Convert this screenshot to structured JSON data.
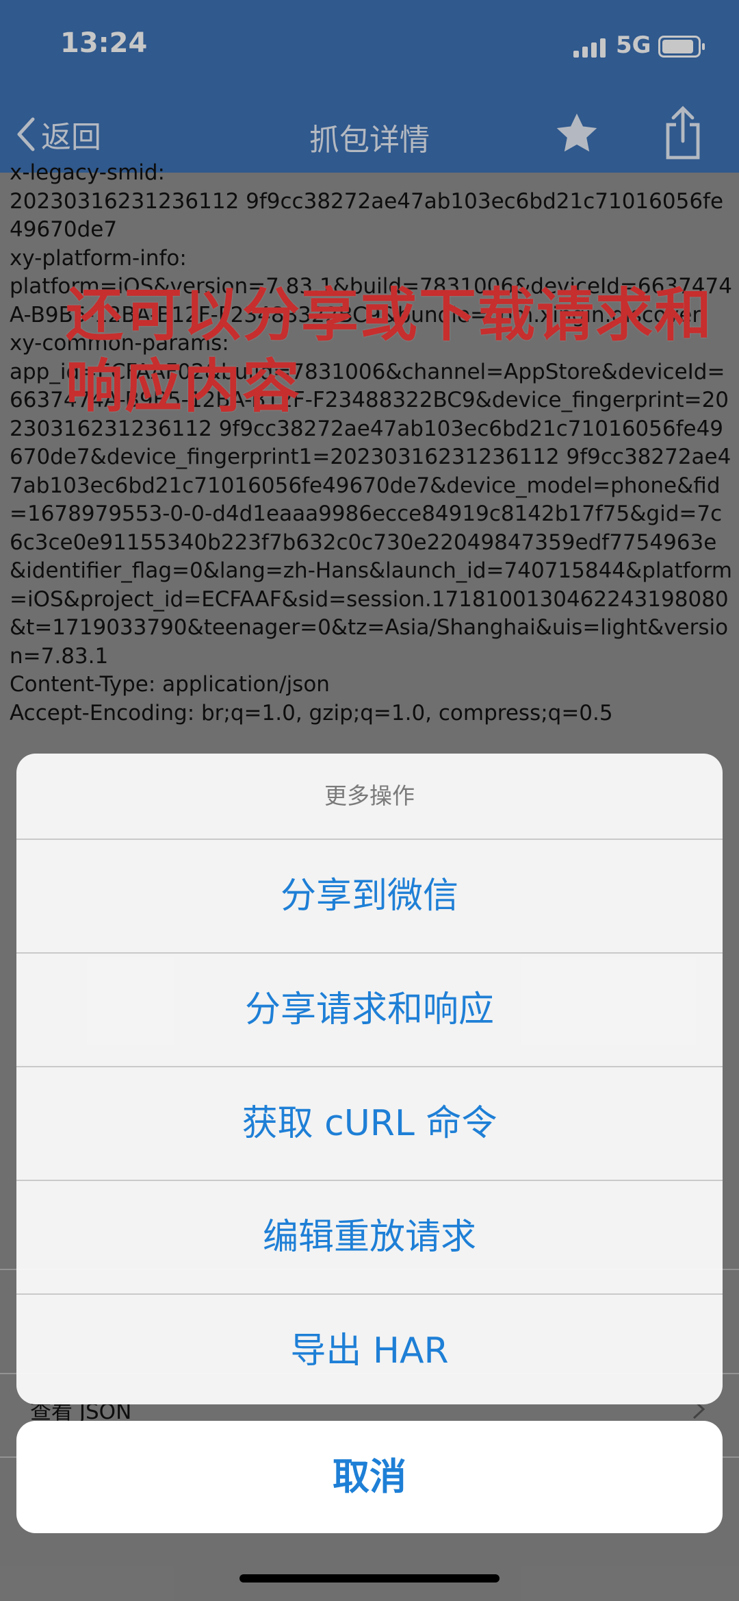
{
  "status": {
    "time": "13:24",
    "network": "5G"
  },
  "nav": {
    "back_label": "返回",
    "title": "抓包详情"
  },
  "content_text": "x-legacy-smid:\n20230316231236112 9f9cc38272ae47ab103ec6bd21c71016056fe49670de7\nxy-platform-info:\nplatform=iOS&version=7.83.1&build=7831006&deviceId=6637474A-B9B5-12BA-B12F-F23488322BC9&bundle=com.xingin.discover\nxy-common-params:\napp_id=ECFAAF02&build=7831006&channel=AppStore&deviceId=6637474A-B9B5-12BA-B12F-F23488322BC9&device_fingerprint=20230316231236112 9f9cc38272ae47ab103ec6bd21c71016056fe49670de7&device_fingerprint1=20230316231236112 9f9cc38272ae47ab103ec6bd21c71016056fe49670de7&device_model=phone&fid=1678979553-0-0-d4d1eaaa9986ecce84919c8142b17f75&gid=7c6c3ce0e91155340b223f7b632c0c730e22049847359edf7754963e&identifier_flag=0&lang=zh-Hans&launch_id=740715844&platform=iOS&project_id=ECFAAF&sid=session.1718100130462243198080&t=1719033790&teenager=0&tz=Asia/Shanghai&uis=light&version=7.83.1\nContent-Type: application/json\nAccept-Encoding: br;q=1.0, gzip;q=1.0, compress;q=0.5",
  "overlay_text": "还可以分享或下载请求和响应内容",
  "underlying_row_label": "查看 JSON",
  "sheet": {
    "title": "更多操作",
    "items": [
      "分享到微信",
      "分享请求和响应",
      "获取 cURL 命令",
      "编辑重放请求",
      "导出 HAR"
    ],
    "cancel": "取消"
  },
  "colors": {
    "nav_bg": "#3e73b5",
    "action_blue": "#1e7fd6",
    "overlay_red": "#ff3b3b"
  }
}
